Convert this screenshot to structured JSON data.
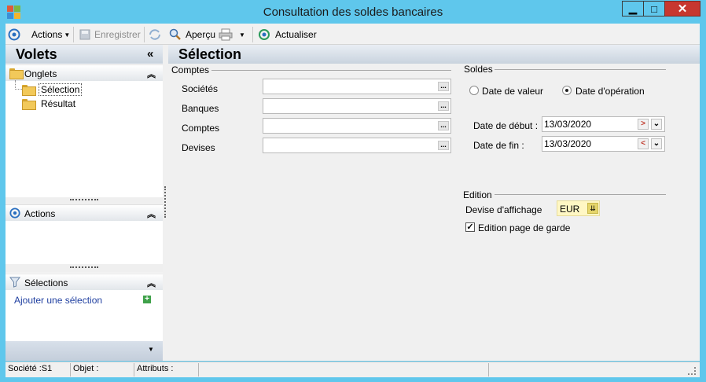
{
  "window": {
    "title": "Consultation des soldes bancaires",
    "minimize": "▁",
    "maximize": "□",
    "close": "✕"
  },
  "toolbar": {
    "actions_label": "Actions",
    "save_label": "Enregistrer",
    "preview_label": "Aperçu",
    "refresh_label": "Actualiser"
  },
  "left_panel": {
    "title": "Volets",
    "collapse_glyph": "«",
    "sections": {
      "onglets": "Onglets",
      "actions": "Actions",
      "selections": "Sélections"
    },
    "tree": [
      "Sélection",
      "Résultat"
    ],
    "add_selection": "Ajouter une sélection"
  },
  "content": {
    "title": "Sélection",
    "comptes_group": {
      "title": "Comptes",
      "fields": [
        {
          "label": "Sociétés",
          "value": ""
        },
        {
          "label": "Banques",
          "value": ""
        },
        {
          "label": "Comptes",
          "value": ""
        },
        {
          "label": "Devises",
          "value": ""
        }
      ],
      "button": "..."
    },
    "soldes_group": {
      "title": "Soldes",
      "radio_value_date": "Date de valeur",
      "radio_operation_date": "Date d'opération",
      "selected": "Date d'opération",
      "start_label": "Date de début :",
      "start_value": "13/03/2020",
      "end_label": "Date de fin :",
      "end_value": "13/03/2020"
    },
    "edition_group": {
      "title": "Edition",
      "currency_label": "Devise d'affichage",
      "currency_value": "EUR",
      "cover_page_label": "Edition page de garde",
      "cover_page_checked": true
    }
  },
  "statusbar": {
    "societe": "Société :S1",
    "objet": "Objet :",
    "attributs": "Attributs :"
  },
  "colors": {
    "chrome": "#5fc7ec",
    "close": "#c7372f",
    "link": "#1f3fa0"
  }
}
